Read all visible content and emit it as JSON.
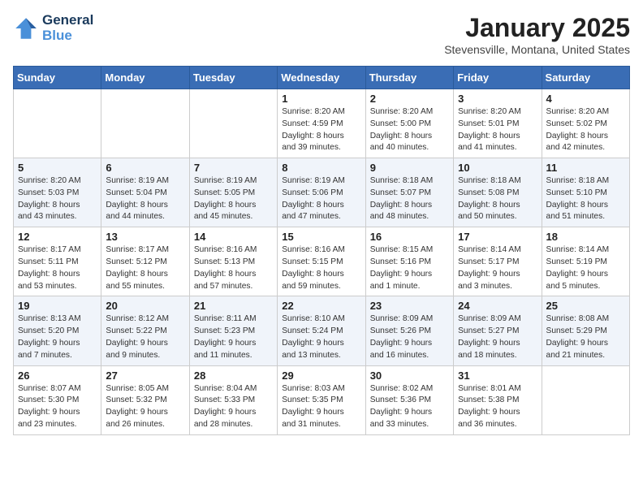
{
  "header": {
    "logo_line1": "General",
    "logo_line2": "Blue",
    "month_title": "January 2025",
    "location": "Stevensville, Montana, United States"
  },
  "weekdays": [
    "Sunday",
    "Monday",
    "Tuesday",
    "Wednesday",
    "Thursday",
    "Friday",
    "Saturday"
  ],
  "weeks": [
    [
      {
        "day": "",
        "info": ""
      },
      {
        "day": "",
        "info": ""
      },
      {
        "day": "",
        "info": ""
      },
      {
        "day": "1",
        "info": "Sunrise: 8:20 AM\nSunset: 4:59 PM\nDaylight: 8 hours\nand 39 minutes."
      },
      {
        "day": "2",
        "info": "Sunrise: 8:20 AM\nSunset: 5:00 PM\nDaylight: 8 hours\nand 40 minutes."
      },
      {
        "day": "3",
        "info": "Sunrise: 8:20 AM\nSunset: 5:01 PM\nDaylight: 8 hours\nand 41 minutes."
      },
      {
        "day": "4",
        "info": "Sunrise: 8:20 AM\nSunset: 5:02 PM\nDaylight: 8 hours\nand 42 minutes."
      }
    ],
    [
      {
        "day": "5",
        "info": "Sunrise: 8:20 AM\nSunset: 5:03 PM\nDaylight: 8 hours\nand 43 minutes."
      },
      {
        "day": "6",
        "info": "Sunrise: 8:19 AM\nSunset: 5:04 PM\nDaylight: 8 hours\nand 44 minutes."
      },
      {
        "day": "7",
        "info": "Sunrise: 8:19 AM\nSunset: 5:05 PM\nDaylight: 8 hours\nand 45 minutes."
      },
      {
        "day": "8",
        "info": "Sunrise: 8:19 AM\nSunset: 5:06 PM\nDaylight: 8 hours\nand 47 minutes."
      },
      {
        "day": "9",
        "info": "Sunrise: 8:18 AM\nSunset: 5:07 PM\nDaylight: 8 hours\nand 48 minutes."
      },
      {
        "day": "10",
        "info": "Sunrise: 8:18 AM\nSunset: 5:08 PM\nDaylight: 8 hours\nand 50 minutes."
      },
      {
        "day": "11",
        "info": "Sunrise: 8:18 AM\nSunset: 5:10 PM\nDaylight: 8 hours\nand 51 minutes."
      }
    ],
    [
      {
        "day": "12",
        "info": "Sunrise: 8:17 AM\nSunset: 5:11 PM\nDaylight: 8 hours\nand 53 minutes."
      },
      {
        "day": "13",
        "info": "Sunrise: 8:17 AM\nSunset: 5:12 PM\nDaylight: 8 hours\nand 55 minutes."
      },
      {
        "day": "14",
        "info": "Sunrise: 8:16 AM\nSunset: 5:13 PM\nDaylight: 8 hours\nand 57 minutes."
      },
      {
        "day": "15",
        "info": "Sunrise: 8:16 AM\nSunset: 5:15 PM\nDaylight: 8 hours\nand 59 minutes."
      },
      {
        "day": "16",
        "info": "Sunrise: 8:15 AM\nSunset: 5:16 PM\nDaylight: 9 hours\nand 1 minute."
      },
      {
        "day": "17",
        "info": "Sunrise: 8:14 AM\nSunset: 5:17 PM\nDaylight: 9 hours\nand 3 minutes."
      },
      {
        "day": "18",
        "info": "Sunrise: 8:14 AM\nSunset: 5:19 PM\nDaylight: 9 hours\nand 5 minutes."
      }
    ],
    [
      {
        "day": "19",
        "info": "Sunrise: 8:13 AM\nSunset: 5:20 PM\nDaylight: 9 hours\nand 7 minutes."
      },
      {
        "day": "20",
        "info": "Sunrise: 8:12 AM\nSunset: 5:22 PM\nDaylight: 9 hours\nand 9 minutes."
      },
      {
        "day": "21",
        "info": "Sunrise: 8:11 AM\nSunset: 5:23 PM\nDaylight: 9 hours\nand 11 minutes."
      },
      {
        "day": "22",
        "info": "Sunrise: 8:10 AM\nSunset: 5:24 PM\nDaylight: 9 hours\nand 13 minutes."
      },
      {
        "day": "23",
        "info": "Sunrise: 8:09 AM\nSunset: 5:26 PM\nDaylight: 9 hours\nand 16 minutes."
      },
      {
        "day": "24",
        "info": "Sunrise: 8:09 AM\nSunset: 5:27 PM\nDaylight: 9 hours\nand 18 minutes."
      },
      {
        "day": "25",
        "info": "Sunrise: 8:08 AM\nSunset: 5:29 PM\nDaylight: 9 hours\nand 21 minutes."
      }
    ],
    [
      {
        "day": "26",
        "info": "Sunrise: 8:07 AM\nSunset: 5:30 PM\nDaylight: 9 hours\nand 23 minutes."
      },
      {
        "day": "27",
        "info": "Sunrise: 8:05 AM\nSunset: 5:32 PM\nDaylight: 9 hours\nand 26 minutes."
      },
      {
        "day": "28",
        "info": "Sunrise: 8:04 AM\nSunset: 5:33 PM\nDaylight: 9 hours\nand 28 minutes."
      },
      {
        "day": "29",
        "info": "Sunrise: 8:03 AM\nSunset: 5:35 PM\nDaylight: 9 hours\nand 31 minutes."
      },
      {
        "day": "30",
        "info": "Sunrise: 8:02 AM\nSunset: 5:36 PM\nDaylight: 9 hours\nand 33 minutes."
      },
      {
        "day": "31",
        "info": "Sunrise: 8:01 AM\nSunset: 5:38 PM\nDaylight: 9 hours\nand 36 minutes."
      },
      {
        "day": "",
        "info": ""
      }
    ]
  ]
}
